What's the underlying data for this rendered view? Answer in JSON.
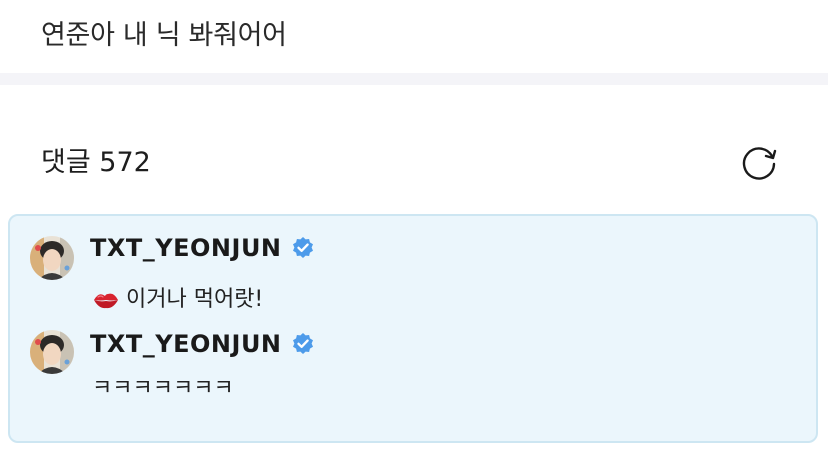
{
  "post": {
    "text": "연준아 내 닉 봐줘어어"
  },
  "comments": {
    "header": "댓글 572",
    "refresh_icon": "refresh-icon"
  },
  "pinned": {
    "background": "#ebf6fc",
    "border": "#cde6f2",
    "items": [
      {
        "username": "TXT_YEONJUN",
        "verified_icon": "verified-badge-icon",
        "emoji_icon": "kiss-mark-icon",
        "text": "이거나 먹어랏!"
      },
      {
        "username": "TXT_YEONJUN",
        "verified_icon": "verified-badge-icon",
        "text": "ㅋㅋㅋㅋㅋㅋㅋ"
      }
    ]
  },
  "colors": {
    "verified": "#4d9bea",
    "kiss": "#d8232f"
  }
}
